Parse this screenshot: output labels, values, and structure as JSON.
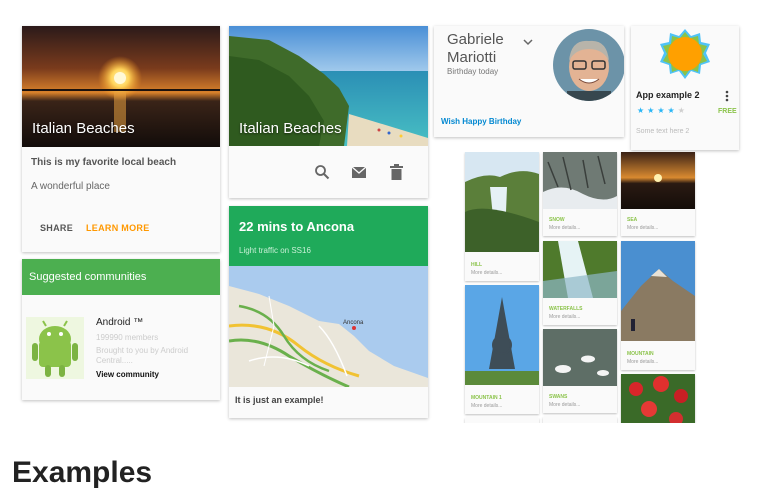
{
  "card_beach_1": {
    "title": "Italian Beaches",
    "headline": "This is my favorite local beach",
    "description": "A wonderful place",
    "share_label": "SHARE",
    "learn_more_label": "LEARN MORE"
  },
  "card_communities": {
    "header": "Suggested communities",
    "name": "Android ™",
    "members": "199990 members",
    "brought_by": "Brought to you by Android Central.....",
    "action_label": "View community"
  },
  "card_beach_2": {
    "title": "Italian Beaches",
    "icons": [
      "search-icon",
      "mail-icon",
      "delete-icon"
    ]
  },
  "card_travel": {
    "title": "22 mins to Ancona",
    "subtitle": "Light traffic on SS16",
    "map_label": "Ancona",
    "footer": "It is just an example!"
  },
  "card_birthday": {
    "first_name": "Gabriele",
    "last_name": "Mariotti",
    "status": "Birthday today",
    "action_label": "Wish Happy Birthday"
  },
  "card_app": {
    "title": "App example 2",
    "rating": 4,
    "rating_max": 5,
    "price": "FREE",
    "placeholder": "Some text here 2"
  },
  "grid": {
    "more_label": "More details...",
    "tiles": [
      {
        "label": "HILL"
      },
      {
        "label": "SNOW"
      },
      {
        "label": "SEA"
      },
      {
        "label": "WATERFALLS"
      },
      {
        "label": "MOUNTAIN"
      },
      {
        "label": "MOUNTAIN 1"
      },
      {
        "label": "SWANS"
      }
    ]
  },
  "section_heading": "Examples",
  "colors": {
    "accent_orange": "#ff9800",
    "green_header": "#4caf50",
    "travel_green": "#1faa5a",
    "link_blue": "#0288d1",
    "tile_green": "#8bc34a"
  }
}
